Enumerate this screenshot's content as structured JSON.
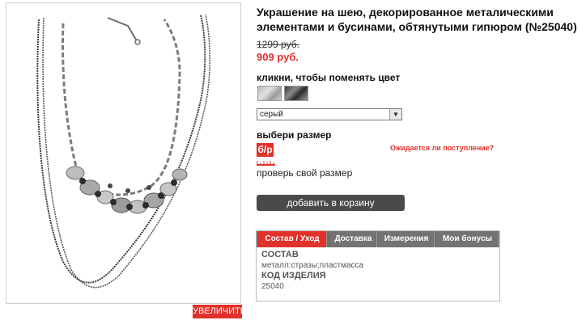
{
  "product": {
    "title": "Украшение на шею, декорированное металическими элементами и бусинами, обтянутыми гипюром (№25040)",
    "old_price": "1299 руб.",
    "new_price": "909 руб.",
    "zoom_label": "УВЕЛИЧИТЬ"
  },
  "color": {
    "label": "кликни, чтобы поменять цвет",
    "swatches": [
      "серый",
      "черный"
    ],
    "selected": "серый"
  },
  "size": {
    "label": "выбери размер",
    "options": [
      "б/р"
    ],
    "check_link": "проверь свой размер",
    "awaiting_link": "Ожидается ли поступление?"
  },
  "cart": {
    "button_label": "добавить в корзину"
  },
  "tabs": {
    "items": [
      "Состав / Уход",
      "Доставка",
      "Измерения",
      "Мои бонусы"
    ],
    "active": "Состав / Уход",
    "content": {
      "composition_title": "СОСТАВ",
      "composition_value": "металл:стразы;пластмасса",
      "code_title": "КОД ИЗДЕЛИЯ",
      "code_value": "25040"
    }
  },
  "colors": {
    "accent": "#e0312b",
    "dark_button": "#4a4a4a",
    "tab_bg": "#737373"
  }
}
